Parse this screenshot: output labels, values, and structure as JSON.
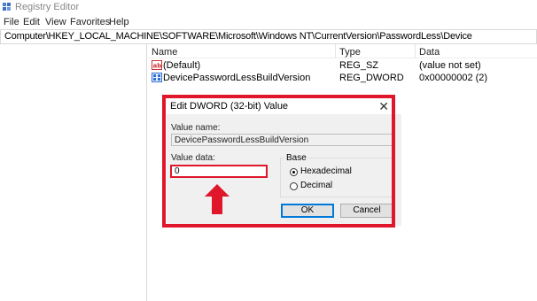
{
  "window": {
    "title": "Registry Editor"
  },
  "menu": [
    "File",
    "Edit",
    "View",
    "Favorites",
    "Help"
  ],
  "address": "Computer\\HKEY_LOCAL_MACHINE\\SOFTWARE\\Microsoft\\Windows NT\\CurrentVersion\\PasswordLess\\Device",
  "list": {
    "columns": {
      "name": "Name",
      "type": "Type",
      "data": "Data"
    },
    "rows": [
      {
        "icon": "string-value-icon",
        "name": "(Default)",
        "type": "REG_SZ",
        "data": "(value not set)"
      },
      {
        "icon": "dword-value-icon",
        "name": "DevicePasswordLessBuildVersion",
        "type": "REG_DWORD",
        "data": "0x00000002 (2)"
      }
    ]
  },
  "dialog": {
    "title": "Edit DWORD (32-bit) Value",
    "value_name_label": "Value name:",
    "value_name": "DevicePasswordLessBuildVersion",
    "value_data_label": "Value data:",
    "value_data": "0",
    "base_label": "Base",
    "base_options": [
      "Hexadecimal",
      "Decimal"
    ],
    "base_selected": "Hexadecimal",
    "ok_label": "OK",
    "cancel_label": "Cancel",
    "close_icon": "close-icon"
  },
  "colors": {
    "highlight": "#e0162b",
    "accent": "#0078d7"
  }
}
